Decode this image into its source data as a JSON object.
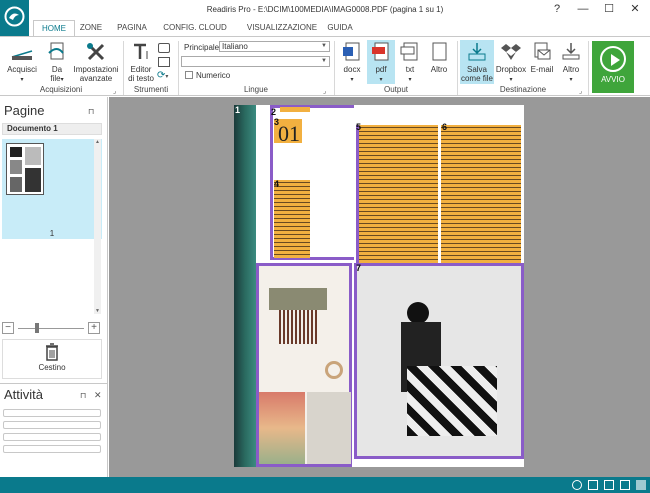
{
  "window": {
    "title": "Readiris Pro - E:\\DCIM\\100MEDIA\\IMAG0008.PDF (pagina 1 su 1)",
    "help": "?",
    "minimize": "—",
    "maximize": "☐",
    "close": "✕"
  },
  "tabs": [
    "HOME",
    "ZONE",
    "PAGINA",
    "CONFIG. CLOUD",
    "VISUALIZZAZIONE",
    "GUIDA"
  ],
  "ribbon": {
    "acquisizione": {
      "label": "Acquisizioni",
      "acquisci": "Acquisci",
      "da_file_1": "Da",
      "da_file_2": "file",
      "impostazioni_1": "Impostazioni",
      "impostazioni_2": "avanzate"
    },
    "strumenti": {
      "label": "Strumenti",
      "editor_1": "Editor",
      "editor_2": "di testo"
    },
    "lingue": {
      "label": "Lingue",
      "principale_label": "Principale",
      "principale_value": "Italiano",
      "secondary_value": "",
      "numerico": "Numerico"
    },
    "output": {
      "label": "Output",
      "docx": "docx",
      "pdf": "pdf",
      "txt": "txt",
      "altro": "Altro"
    },
    "destinazione": {
      "label": "Destinazione",
      "salva_1": "Salva",
      "salva_2": "come file",
      "dropbox": "Dropbox",
      "email": "E-mail",
      "altro": "Altro"
    },
    "avvio": "AVVIO"
  },
  "pages_panel": {
    "title": "Pagine",
    "document": "Documento 1",
    "page_number": "1",
    "trash": "Cestino"
  },
  "activity_panel": {
    "title": "Attività",
    "rows": 4
  },
  "zones": {
    "z1": "1",
    "z2": "2",
    "z3": "3",
    "z4": "4",
    "z5": "5",
    "z6": "6",
    "z7": "7",
    "big_number": "01"
  },
  "colors": {
    "teal": "#0a7a8c",
    "text_zone": "#f2b040",
    "image_zone": "#8a5cc8",
    "avvio_green": "#3fa53b",
    "highlight": "#b8e4f2"
  }
}
